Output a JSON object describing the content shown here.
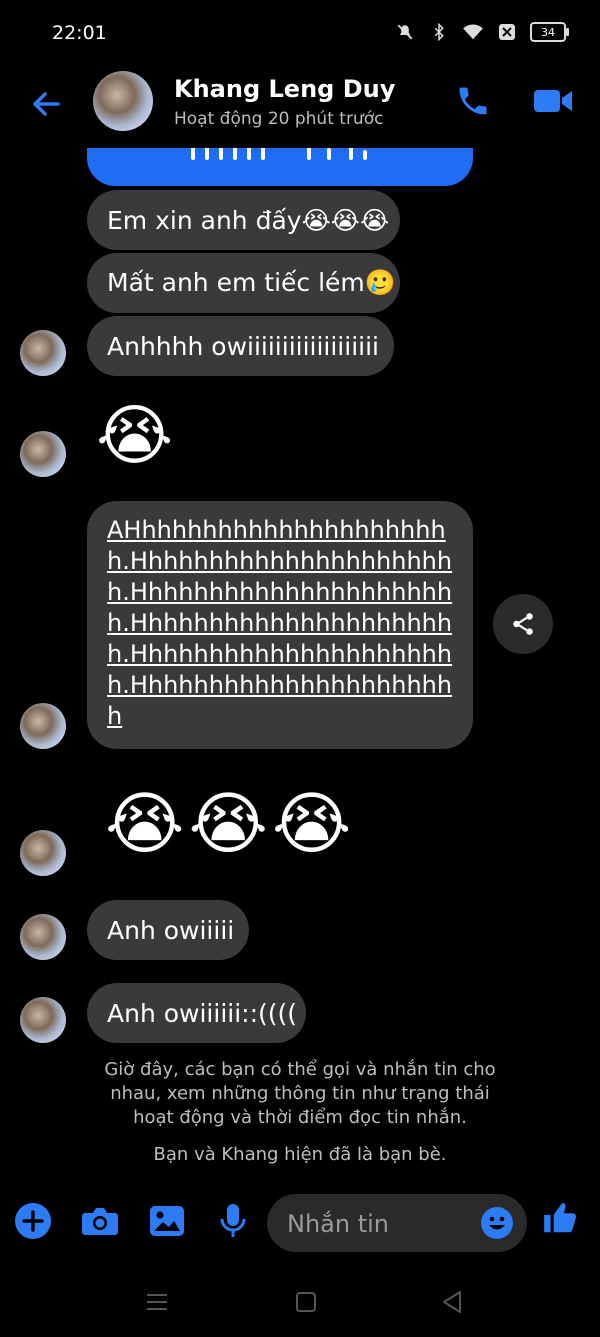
{
  "status_bar": {
    "time": "22:01",
    "battery": "34",
    "icons": [
      "mute-icon",
      "bluetooth-icon",
      "wifi-icon",
      "close-box-icon",
      "battery-icon"
    ]
  },
  "header": {
    "contact_name": "Khang Leng Duy",
    "contact_status": "Hoạt động 20 phút trước",
    "icons": [
      "back-arrow-icon",
      "phone-icon",
      "video-camera-icon"
    ]
  },
  "messages": {
    "m1": "Em xin anh đấy😭😭😭",
    "m2": "Mất anh em tiếc lém🥲",
    "m3": "Anhhhh owiiiiiiiiiiiiiiiiiii",
    "emoji_single": "😭",
    "long_text": "AHhhhhhhhhhhhhhhhhhhhhh.Hhhhhhhhhhhhhhhhhhhhhh.Hhhhhhhhhhhhhhhhhhhhhh.Hhhhhhhhhhhhhhhhhhhhhh.Hhhhhhhhhhhhhhhhhhhhhh.Hhhhhhhhhhhhhhhhhhhhhh",
    "emoji_triple": "😭😭😭",
    "m4": "Anh owiiiii",
    "m5": "Anh owiiiiii::(((("
  },
  "info": {
    "notice": "Giờ đây, các bạn có thể gọi và nhắn tin cho nhau, xem những thông tin như trạng thái hoạt động và thời điểm đọc tin nhắn.",
    "friends": "Bạn và Khang hiện đã là bạn bè."
  },
  "composer": {
    "placeholder": "Nhắn tin",
    "icons": [
      "plus-icon",
      "camera-icon",
      "gallery-icon",
      "microphone-icon",
      "emoji-icon",
      "thumbs-up-icon"
    ]
  },
  "colors": {
    "accent": "#1f6cf5",
    "bubble": "#3a3a3c",
    "background": "#000000"
  }
}
